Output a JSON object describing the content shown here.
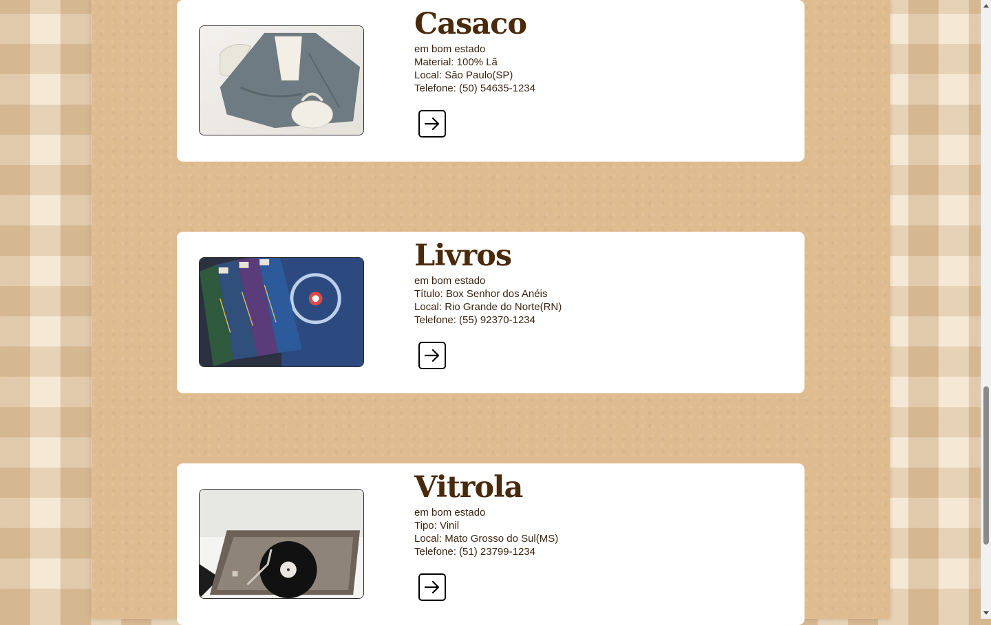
{
  "products": [
    {
      "title": "Casaco",
      "condition": "em bom estado",
      "detail": "Material: 100% Lã",
      "location": "Local: São Paulo(SP)",
      "phone": "Telefone: (50) 54635-1234",
      "image_icon": "coat-photo",
      "button_icon": "arrow-right-icon"
    },
    {
      "title": "Livros",
      "condition": "em bom estado",
      "detail": "Título: Box Senhor dos Anéis",
      "location": "Local: Rio Grande do Norte(RN)",
      "phone": "Telefone: (55) 92370-1234",
      "image_icon": "books-photo",
      "button_icon": "arrow-right-icon"
    },
    {
      "title": "Vitrola",
      "condition": "em bom estado",
      "detail": "Tipo: Vinil",
      "location": "Local: Mato Grosso do Sul(MS)",
      "phone": "Telefone: (51) 23799-1234",
      "image_icon": "record-player-photo",
      "button_icon": "arrow-right-icon"
    }
  ],
  "colors": {
    "title": "#4a2a0c",
    "text": "#3b2410",
    "card": "#ffffff",
    "panel": "#dfbb90",
    "background": "#ecdcc3"
  }
}
